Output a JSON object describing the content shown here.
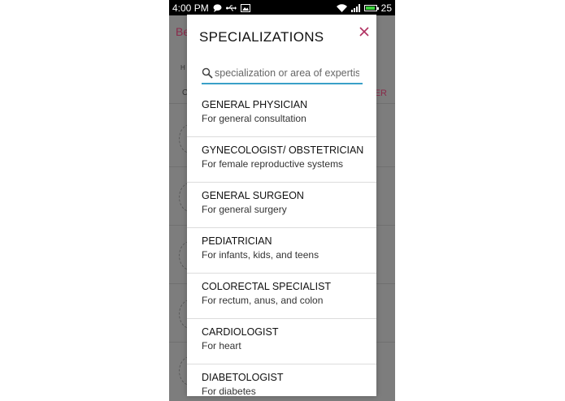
{
  "status_bar": {
    "time": "4:00 PM",
    "battery_level": "25",
    "icons": [
      "chat-icon",
      "usb-icon",
      "image-icon",
      "wifi-icon",
      "signal-icon",
      "battery-icon"
    ]
  },
  "background": {
    "header": "Be",
    "tab": "H",
    "left_text": "C",
    "right_text": "ER"
  },
  "dialog": {
    "title": "SPECIALIZATIONS",
    "close_icon": "close-icon",
    "search": {
      "placeholder": "specialization or area of expertise",
      "value": ""
    },
    "items": [
      {
        "title": "GENERAL PHYSICIAN",
        "subtitle": "For general consultation"
      },
      {
        "title": "GYNECOLOGIST/ OBSTETRICIAN",
        "subtitle": "For female reproductive systems"
      },
      {
        "title": "GENERAL SURGEON",
        "subtitle": "For general surgery"
      },
      {
        "title": "PEDIATRICIAN",
        "subtitle": "For infants, kids, and teens"
      },
      {
        "title": "COLORECTAL SPECIALIST",
        "subtitle": "For rectum, anus, and colon"
      },
      {
        "title": "CARDIOLOGIST",
        "subtitle": "For heart"
      },
      {
        "title": "DIABETOLOGIST",
        "subtitle": "For diabetes"
      }
    ]
  },
  "colors": {
    "accent": "#b03060",
    "search_underline": "#3aa0c8",
    "overlay": "#7d7d7d"
  }
}
